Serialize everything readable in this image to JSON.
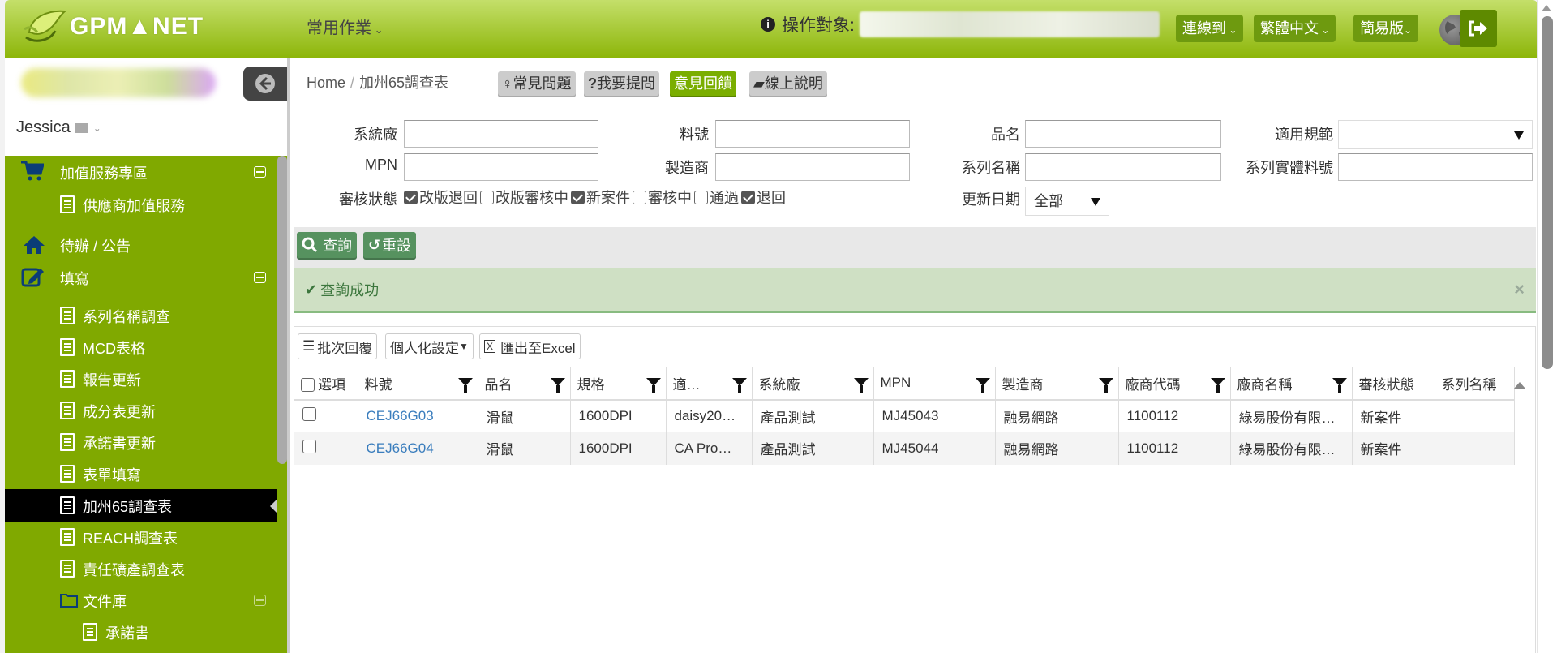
{
  "header": {
    "logo_text": "GPM▲NET",
    "common_tasks": "常用作業",
    "target_label": "操作對象:",
    "connect_to": "連線到",
    "language": "繁體中文",
    "mode": "簡易版"
  },
  "sidebar": {
    "user_name": "Jessica",
    "items": [
      {
        "label": "加值服務專區",
        "icon": "cart-icon",
        "level": 0,
        "toggle": true
      },
      {
        "label": "供應商加值服務",
        "icon": "file-icon",
        "level": 1
      },
      {
        "label": "待辦 / 公告",
        "icon": "home-icon",
        "level": 0
      },
      {
        "label": "填寫",
        "icon": "edit-icon",
        "level": 0,
        "toggle": true
      },
      {
        "label": "系列名稱調查",
        "icon": "file-icon",
        "level": 1
      },
      {
        "label": "MCD表格",
        "icon": "file-icon",
        "level": 1
      },
      {
        "label": "報告更新",
        "icon": "file-icon",
        "level": 1
      },
      {
        "label": "成分表更新",
        "icon": "file-icon",
        "level": 1
      },
      {
        "label": "承諾書更新",
        "icon": "file-icon",
        "level": 1
      },
      {
        "label": "表單填寫",
        "icon": "file-icon",
        "level": 1
      },
      {
        "label": "加州65調查表",
        "icon": "file-icon",
        "level": 1,
        "active": true
      },
      {
        "label": "REACH調查表",
        "icon": "file-icon",
        "level": 1
      },
      {
        "label": "責任礦產調查表",
        "icon": "file-icon",
        "level": 1
      },
      {
        "label": "文件庫",
        "icon": "folder-icon",
        "level": 1,
        "toggle": true
      },
      {
        "label": "承諾書",
        "icon": "file-icon",
        "level": 2
      }
    ]
  },
  "breadcrumb": {
    "home": "Home",
    "current": "加州65調查表"
  },
  "quick_buttons": {
    "faq": "常見問題",
    "ask": "我要提問",
    "feedback": "意見回饋",
    "manual": "線上說明"
  },
  "filters": {
    "system_factory": {
      "label": "系統廠",
      "value": ""
    },
    "part_no": {
      "label": "料號",
      "value": ""
    },
    "product_name": {
      "label": "品名",
      "value": ""
    },
    "regulation": {
      "label": "適用規範",
      "value": ""
    },
    "mpn": {
      "label": "MPN",
      "value": ""
    },
    "manufacturer": {
      "label": "製造商",
      "value": ""
    },
    "series_name": {
      "label": "系列名稱",
      "value": ""
    },
    "series_part": {
      "label": "系列實體料號",
      "value": ""
    },
    "review_status": {
      "label": "審核狀態",
      "options": [
        {
          "label": "改版退回",
          "checked": true
        },
        {
          "label": "改版審核中",
          "checked": false
        },
        {
          "label": "新案件",
          "checked": true
        },
        {
          "label": "審核中",
          "checked": false
        },
        {
          "label": "通過",
          "checked": false
        },
        {
          "label": "退回",
          "checked": true
        }
      ]
    },
    "update_date": {
      "label": "更新日期",
      "value": "全部"
    }
  },
  "actions": {
    "search": "查詢",
    "reset": "重設"
  },
  "alert": {
    "message": "查詢成功",
    "close": "×"
  },
  "grid": {
    "toolbar": {
      "batch_reply": "批次回覆",
      "personalize": "個人化設定",
      "export": "匯出至Excel"
    },
    "columns": [
      "選項",
      "料號",
      "品名",
      "規格",
      "適…",
      "系統廠",
      "MPN",
      "製造商",
      "廠商代碼",
      "廠商名稱",
      "審核狀態",
      "系列名稱"
    ],
    "rows": [
      {
        "checked": false,
        "part_no": "CEJ66G03",
        "name": "滑鼠",
        "spec": "1600DPI",
        "regulation": "daisy20…",
        "system_factory": "產品測試",
        "mpn": "MJ45043",
        "manufacturer": "融易網路",
        "vendor_code": "1100112",
        "vendor_name": "綠易股份有限…",
        "status": "新案件",
        "series": ""
      },
      {
        "checked": false,
        "part_no": "CEJ66G04",
        "name": "滑鼠",
        "spec": "1600DPI",
        "regulation": "CA Pro…",
        "system_factory": "產品測試",
        "mpn": "MJ45044",
        "manufacturer": "融易網路",
        "vendor_code": "1100112",
        "vendor_name": "綠易股份有限…",
        "status": "新案件",
        "series": ""
      }
    ]
  }
}
